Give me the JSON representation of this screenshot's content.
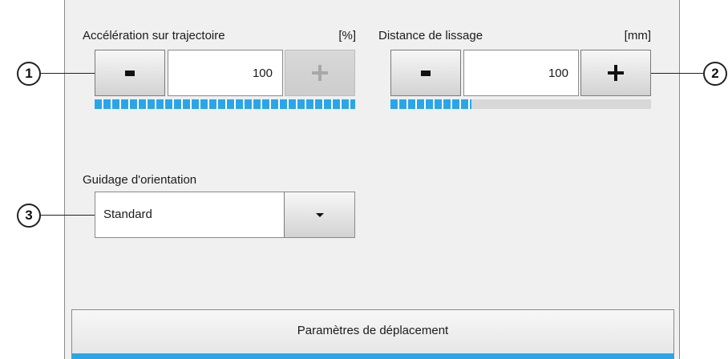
{
  "acceleration": {
    "label": "Accélération sur trajectoire",
    "unit": "[%]",
    "value": "100",
    "minus_label": "-",
    "plus_label": "+",
    "plus_enabled": false,
    "level_fraction": 1.0
  },
  "smoothing": {
    "label": "Distance de lissage",
    "unit": "[mm]",
    "value": "100",
    "minus_label": "-",
    "plus_label": "+",
    "plus_enabled": true,
    "level_fraction": 0.31
  },
  "orientation": {
    "label": "Guidage d'orientation",
    "selected": "Standard"
  },
  "callouts": [
    "1",
    "2",
    "3"
  ],
  "tab": {
    "label": "Paramètres de déplacement"
  },
  "colors": {
    "accent": "#2aa6e8",
    "panel": "#f0f0f0"
  },
  "icons": {
    "dropdown": "chevron-down-icon",
    "plus": "plus-icon",
    "minus": "minus-icon"
  }
}
